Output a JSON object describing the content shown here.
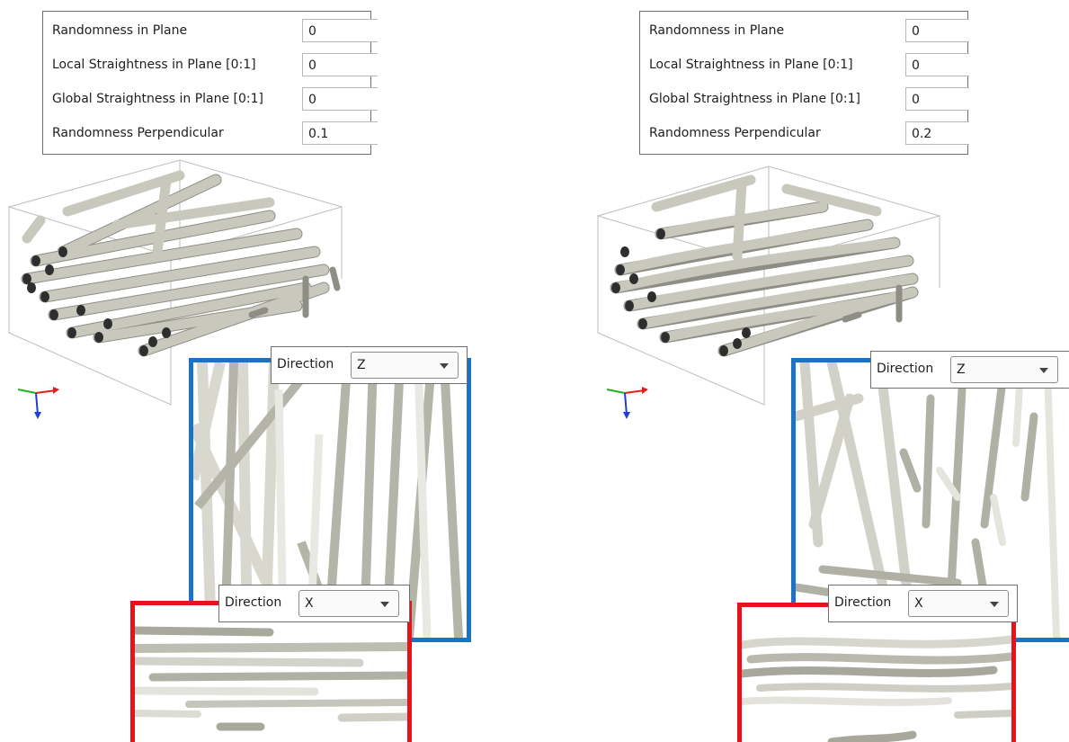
{
  "panels": [
    {
      "params": [
        {
          "label": "Randomness in Plane",
          "value": "0"
        },
        {
          "label": "Local Straightness in Plane [0:1]",
          "value": "0"
        },
        {
          "label": "Global Straightness in Plane [0:1]",
          "value": "0"
        },
        {
          "label": "Randomness Perpendicular",
          "value": "0.1"
        }
      ],
      "direction_z": {
        "label": "Direction",
        "value": "Z"
      },
      "direction_x": {
        "label": "Direction",
        "value": "X"
      }
    },
    {
      "params": [
        {
          "label": "Randomness in Plane",
          "value": "0"
        },
        {
          "label": "Local Straightness in Plane [0:1]",
          "value": "0"
        },
        {
          "label": "Global Straightness in Plane [0:1]",
          "value": "0"
        },
        {
          "label": "Randomness Perpendicular",
          "value": "0.2"
        }
      ],
      "direction_z": {
        "label": "Direction",
        "value": "Z"
      },
      "direction_x": {
        "label": "Direction",
        "value": "X"
      }
    }
  ],
  "colors": {
    "slice_z_border": "#1a73c4",
    "slice_x_border": "#e8121a",
    "fiber": "#c9c8bc",
    "fiber_shadow": "#8f8e84",
    "fiber_end": "#2e2e2e",
    "axis_x": "#e02020",
    "axis_y": "#20b020",
    "axis_z": "#1f3fd0"
  }
}
